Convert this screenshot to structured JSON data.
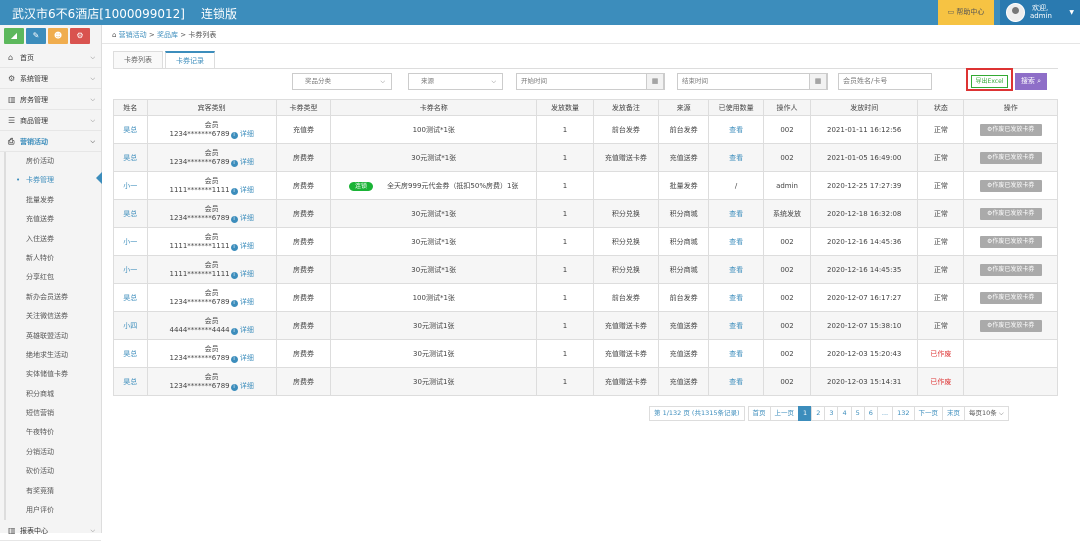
{
  "header": {
    "title": "武汉市6不6酒店[1000099012]",
    "edition": "连锁版",
    "help": "帮助中心",
    "welcome": "欢迎,",
    "user": "admin"
  },
  "sidebar": {
    "tool_icons": [
      {
        "icon": "chart-icon",
        "glyph": "◢",
        "color": "#5cb85c"
      },
      {
        "icon": "edit-icon",
        "glyph": "✎",
        "color": "#3c8dbc"
      },
      {
        "icon": "users-icon",
        "glyph": "☻",
        "color": "#f0ad4e"
      },
      {
        "icon": "settings-icon",
        "glyph": "⚙",
        "color": "#d9534f"
      }
    ],
    "items": [
      {
        "label": "首页",
        "glyph": "⌂"
      },
      {
        "label": "系统管理",
        "glyph": "⚙"
      },
      {
        "label": "房务管理",
        "glyph": "▥"
      },
      {
        "label": "商品管理",
        "glyph": "☰"
      },
      {
        "label": "营销活动",
        "glyph": "⎙"
      }
    ],
    "subitems": [
      "房价活动",
      "卡券管理",
      "批量发券",
      "充值送券",
      "入住送券",
      "新人特价",
      "分享红包",
      "新办会员送券",
      "关注微信送券",
      "英雄联盟活动",
      "绝地求生活动",
      "实体储值卡券",
      "积分商城",
      "短信营销",
      "午夜特价",
      "分销活动",
      "砍价活动",
      "有奖竞猜",
      "用户评价"
    ],
    "bottom_item": "报表中心"
  },
  "breadcrumb": {
    "home": "营销活动",
    "sep": ">",
    "level2": "奖品库",
    "level3": "卡券列表"
  },
  "tabs": [
    "卡券列表",
    "卡券记录"
  ],
  "filters": {
    "category": "奖品分类",
    "source": "来源",
    "start": "开始时间",
    "end": "结束时间",
    "keyword": "会员姓名/卡号",
    "export": "导出Excel",
    "search": "搜索"
  },
  "table": {
    "headers": [
      "姓名",
      "宾客类别",
      "卡券类型",
      "卡券名称",
      "发放数量",
      "发放备注",
      "来源",
      "已使用数量",
      "操作人",
      "发放时间",
      "状态",
      "操作"
    ],
    "rows": [
      {
        "name": "昊总",
        "cat": "会员",
        "card": "1234*******6789",
        "detail": "详细",
        "type": "充值券",
        "tag": "",
        "title": "100测试*1张",
        "qty": "1",
        "note": "前台发券",
        "src": "前台发券",
        "used": "查看",
        "op": "002",
        "time": "2021-01-11 16:12:56",
        "status": "正常",
        "action": "作废已发放卡券"
      },
      {
        "name": "昊总",
        "cat": "会员",
        "card": "1234*******6789",
        "detail": "详细",
        "type": "房费券",
        "tag": "",
        "title": "30元测试*1张",
        "qty": "1",
        "note": "充值赠送卡券",
        "src": "充值送券",
        "used": "查看",
        "op": "002",
        "time": "2021-01-05 16:49:00",
        "status": "正常",
        "action": "作废已发放卡券"
      },
      {
        "name": "小一",
        "cat": "会员",
        "card": "1111*******1111",
        "detail": "详细",
        "type": "房费券",
        "tag": "连锁",
        "title": "全天房999元代金券（抵扣50%房费）1张",
        "qty": "1",
        "note": "",
        "src": "批量发券",
        "used": "/",
        "op": "admin",
        "time": "2020-12-25 17:27:39",
        "status": "正常",
        "action": "作废已发放卡券"
      },
      {
        "name": "昊总",
        "cat": "会员",
        "card": "1234*******6789",
        "detail": "详细",
        "type": "房费券",
        "tag": "",
        "title": "30元测试*1张",
        "qty": "1",
        "note": "积分兑换",
        "src": "积分商城",
        "used": "查看",
        "op": "系统发放",
        "time": "2020-12-18 16:32:08",
        "status": "正常",
        "action": "作废已发放卡券"
      },
      {
        "name": "小一",
        "cat": "会员",
        "card": "1111*******1111",
        "detail": "详细",
        "type": "房费券",
        "tag": "",
        "title": "30元测试*1张",
        "qty": "1",
        "note": "积分兑换",
        "src": "积分商城",
        "used": "查看",
        "op": "002",
        "time": "2020-12-16 14:45:36",
        "status": "正常",
        "action": "作废已发放卡券"
      },
      {
        "name": "小一",
        "cat": "会员",
        "card": "1111*******1111",
        "detail": "详细",
        "type": "房费券",
        "tag": "",
        "title": "30元测试*1张",
        "qty": "1",
        "note": "积分兑换",
        "src": "积分商城",
        "used": "查看",
        "op": "002",
        "time": "2020-12-16 14:45:35",
        "status": "正常",
        "action": "作废已发放卡券"
      },
      {
        "name": "昊总",
        "cat": "会员",
        "card": "1234*******6789",
        "detail": "详细",
        "type": "房费券",
        "tag": "",
        "title": "100测试*1张",
        "qty": "1",
        "note": "前台发券",
        "src": "前台发券",
        "used": "查看",
        "op": "002",
        "time": "2020-12-07 16:17:27",
        "status": "正常",
        "action": "作废已发放卡券"
      },
      {
        "name": "小四",
        "cat": "会员",
        "card": "4444*******4444",
        "detail": "详细",
        "type": "房费券",
        "tag": "",
        "title": "30元测试1张",
        "qty": "1",
        "note": "充值赠送卡券",
        "src": "充值送券",
        "used": "查看",
        "op": "002",
        "time": "2020-12-07 15:38:10",
        "status": "正常",
        "action": "作废已发放卡券"
      },
      {
        "name": "昊总",
        "cat": "会员",
        "card": "1234*******6789",
        "detail": "详细",
        "type": "房费券",
        "tag": "",
        "title": "30元测试1张",
        "qty": "1",
        "note": "充值赠送卡券",
        "src": "充值送券",
        "used": "查看",
        "op": "002",
        "time": "2020-12-03 15:20:43",
        "status": "已作废",
        "action": ""
      },
      {
        "name": "昊总",
        "cat": "会员",
        "card": "1234*******6789",
        "detail": "详细",
        "type": "房费券",
        "tag": "",
        "title": "30元测试1张",
        "qty": "1",
        "note": "充值赠送卡券",
        "src": "充值送券",
        "used": "查看",
        "op": "002",
        "time": "2020-12-03 15:14:31",
        "status": "已作废",
        "action": ""
      }
    ]
  },
  "pager": {
    "info": "第 1/132 页 (共1315条记录)",
    "first": "首页",
    "prev": "上一页",
    "pages": [
      "1",
      "2",
      "3",
      "4",
      "5",
      "6",
      "...",
      "132"
    ],
    "next": "下一页",
    "last": "末页",
    "per_page": "每页10条"
  }
}
